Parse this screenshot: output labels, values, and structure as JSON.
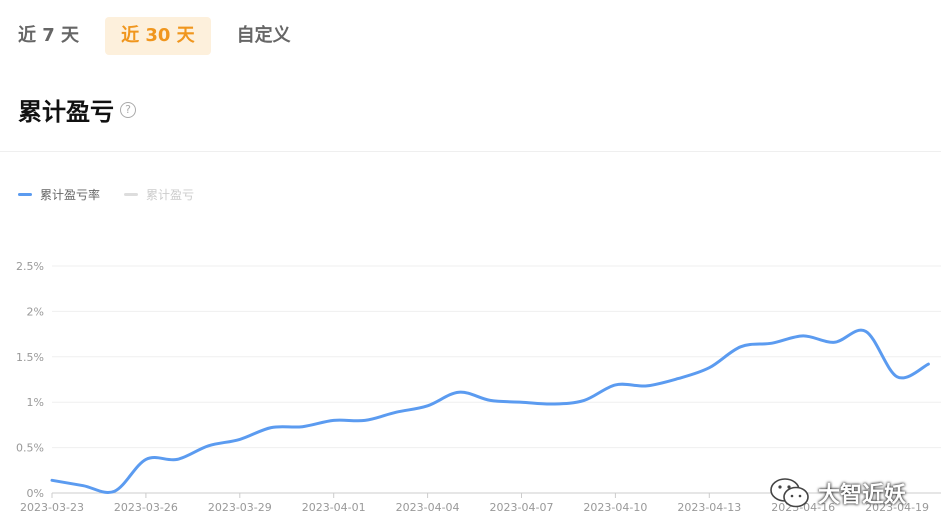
{
  "tabs": [
    {
      "label": "近 7 天",
      "active": false
    },
    {
      "label": "近 30 天",
      "active": true
    },
    {
      "label": "自定义",
      "active": false
    }
  ],
  "section_title": "累计盈亏",
  "help_glyph": "?",
  "legend": [
    {
      "label": "累计盈亏率",
      "color": "#5b9bf0",
      "active": true
    },
    {
      "label": "累计盈亏",
      "color": "#dddddd",
      "active": false
    }
  ],
  "watermark_text": "大智近妖",
  "chart_data": {
    "type": "line",
    "title": "",
    "xlabel": "",
    "ylabel": "",
    "y_tick_labels": [
      "0%",
      "0.5%",
      "1%",
      "1.5%",
      "2%",
      "2.5%"
    ],
    "y_ticks": [
      0,
      0.5,
      1,
      1.5,
      2,
      2.5
    ],
    "ylim": [
      0,
      2.5
    ],
    "x_tick_labels": [
      "2023-03-23",
      "2023-03-26",
      "2023-03-29",
      "2023-04-01",
      "2023-04-04",
      "2023-04-07",
      "2023-04-10",
      "2023-04-13",
      "2023-04-16",
      "2023-04-19"
    ],
    "grid": true,
    "legend_position": "top-left",
    "series": [
      {
        "name": "累计盈亏率",
        "color": "#5b9bf0",
        "x": [
          "2023-03-23",
          "2023-03-24",
          "2023-03-25",
          "2023-03-26",
          "2023-03-27",
          "2023-03-28",
          "2023-03-29",
          "2023-03-30",
          "2023-03-31",
          "2023-04-01",
          "2023-04-02",
          "2023-04-03",
          "2023-04-04",
          "2023-04-05",
          "2023-04-06",
          "2023-04-07",
          "2023-04-08",
          "2023-04-09",
          "2023-04-10",
          "2023-04-11",
          "2023-04-12",
          "2023-04-13",
          "2023-04-14",
          "2023-04-15",
          "2023-04-16",
          "2023-04-17",
          "2023-04-18",
          "2023-04-19",
          "2023-04-20"
        ],
        "values": [
          0.14,
          0.08,
          0.02,
          0.37,
          0.37,
          0.52,
          0.59,
          0.72,
          0.73,
          0.8,
          0.8,
          0.89,
          0.96,
          1.11,
          1.02,
          1.0,
          0.98,
          1.02,
          1.19,
          1.18,
          1.26,
          1.38,
          1.61,
          1.65,
          1.73,
          1.66,
          1.78,
          1.28,
          1.42
        ]
      }
    ]
  }
}
